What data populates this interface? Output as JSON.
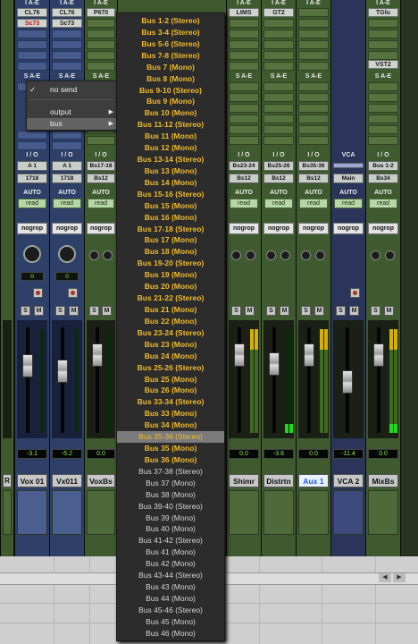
{
  "context_menu": {
    "check": "✓",
    "items": [
      "no send",
      "output",
      "bus"
    ]
  },
  "bus_menu": {
    "items": [
      {
        "label": "Bus 1-2 (Stereo)",
        "state": "used"
      },
      {
        "label": "Bus 3-4 (Stereo)",
        "state": "used"
      },
      {
        "label": "Bus 5-6 (Stereo)",
        "state": "used"
      },
      {
        "label": "Bus 7-8 (Stereo)",
        "state": "used"
      },
      {
        "label": "Bus 7 (Mono)",
        "state": "used"
      },
      {
        "label": "Bus 8 (Mono)",
        "state": "used"
      },
      {
        "label": "Bus 9-10 (Stereo)",
        "state": "used"
      },
      {
        "label": "Bus 9 (Mono)",
        "state": "used"
      },
      {
        "label": "Bus 10 (Mono)",
        "state": "used"
      },
      {
        "label": "Bus 11-12 (Stereo)",
        "state": "used"
      },
      {
        "label": "Bus 11 (Mono)",
        "state": "used"
      },
      {
        "label": "Bus 12 (Mono)",
        "state": "used"
      },
      {
        "label": "Bus 13-14 (Stereo)",
        "state": "used"
      },
      {
        "label": "Bus 13 (Mono)",
        "state": "used"
      },
      {
        "label": "Bus 14 (Mono)",
        "state": "used"
      },
      {
        "label": "Bus 15-16 (Stereo)",
        "state": "used"
      },
      {
        "label": "Bus 15 (Mono)",
        "state": "used"
      },
      {
        "label": "Bus 16 (Mono)",
        "state": "used"
      },
      {
        "label": "Bus 17-18 (Stereo)",
        "state": "used"
      },
      {
        "label": "Bus 17 (Mono)",
        "state": "used"
      },
      {
        "label": "Bus 18 (Mono)",
        "state": "used"
      },
      {
        "label": "Bus 19-20 (Stereo)",
        "state": "used"
      },
      {
        "label": "Bus 19 (Mono)",
        "state": "used"
      },
      {
        "label": "Bus 20 (Mono)",
        "state": "used"
      },
      {
        "label": "Bus 21-22 (Stereo)",
        "state": "used"
      },
      {
        "label": "Bus 21 (Mono)",
        "state": "used"
      },
      {
        "label": "Bus 22 (Mono)",
        "state": "used"
      },
      {
        "label": "Bus 23-24 (Stereo)",
        "state": "used"
      },
      {
        "label": "Bus 23 (Mono)",
        "state": "used"
      },
      {
        "label": "Bus 24 (Mono)",
        "state": "used"
      },
      {
        "label": "Bus 25-26 (Stereo)",
        "state": "used"
      },
      {
        "label": "Bus 25 (Mono)",
        "state": "used"
      },
      {
        "label": "Bus 26 (Mono)",
        "state": "used"
      },
      {
        "label": "Bus 33-34 (Stereo)",
        "state": "used"
      },
      {
        "label": "Bus 33 (Mono)",
        "state": "used"
      },
      {
        "label": "Bus 34 (Mono)",
        "state": "used"
      },
      {
        "label": "Bus 35-36 (Stereo)",
        "state": "highlighted"
      },
      {
        "label": "Bus 35 (Mono)",
        "state": "used"
      },
      {
        "label": "Bus 36 (Mono)",
        "state": "used"
      },
      {
        "label": "Bus 37-38 (Stereo)",
        "state": "free"
      },
      {
        "label": "Bus 37 (Mono)",
        "state": "free"
      },
      {
        "label": "Bus 38 (Mono)",
        "state": "free"
      },
      {
        "label": "Bus 39-40 (Stereo)",
        "state": "free"
      },
      {
        "label": "Bus 39 (Mono)",
        "state": "free"
      },
      {
        "label": "Bus 40 (Mono)",
        "state": "free"
      },
      {
        "label": "Bus 41-42 (Stereo)",
        "state": "free"
      },
      {
        "label": "Bus 41 (Mono)",
        "state": "free"
      },
      {
        "label": "Bus 42 (Mono)",
        "state": "free"
      },
      {
        "label": "Bus 43-44 (Stereo)",
        "state": "free"
      },
      {
        "label": "Bus 43 (Mono)",
        "state": "free"
      },
      {
        "label": "Bus 44 (Mono)",
        "state": "free"
      },
      {
        "label": "Bus 45-46 (Stereo)",
        "state": "free"
      },
      {
        "label": "Bus 45 (Mono)",
        "state": "free"
      },
      {
        "label": "Bus 46 (Mono)",
        "state": "free"
      }
    ]
  },
  "colors": {
    "used_bus": "#f0bb2d",
    "free_bus": "#d4d4d4",
    "volume_text": "#93e35b",
    "track_green": "#3f5a2f",
    "track_blue": "#2f4068"
  },
  "labels": {
    "sends_header": "S A-E",
    "io_header": "I / O",
    "auto_header": "AUTO",
    "read": "read",
    "nogroup": "nogrop",
    "solo": "S",
    "mute": "M",
    "vca_header": "VCA",
    "inserts_header": "I A-E"
  },
  "strips": [
    {
      "id": "s0",
      "name": "R",
      "color": "green",
      "insert1": "",
      "insert2": "",
      "input": "",
      "output": "",
      "volume": ""
    },
    {
      "id": "s1",
      "name": "Vox 01",
      "color": "blue",
      "insert1": "CL76",
      "insert2": "Sc73",
      "input": "A 1",
      "output": "1718",
      "volume": "-3.1",
      "pan": "0"
    },
    {
      "id": "s2",
      "name": "Vx011",
      "color": "blue",
      "insert1": "CL76",
      "insert2": "Sc73",
      "input": "A 1",
      "output": "1718",
      "volume": "-5.2",
      "pan": "0"
    },
    {
      "id": "s3",
      "name": "VoxBs",
      "color": "green",
      "insert1": "P670",
      "insert2": "",
      "input": "Bs17-18",
      "output": "Bs12",
      "volume": "0.0"
    },
    {
      "id": "s4",
      "name": "Shimr",
      "color": "green",
      "insert1": "LtMS",
      "insert2": "",
      "input": "Bs23-24",
      "output": "Bs12",
      "volume": "0.0"
    },
    {
      "id": "s5",
      "name": "Distrtn",
      "color": "green",
      "insert1": "GT2",
      "insert2": "",
      "input": "Bs25-26",
      "output": "Bs12",
      "volume": "-3.6"
    },
    {
      "id": "s6",
      "name": "Aux 1",
      "color": "green",
      "insert1": "",
      "insert2": "",
      "input": "Bs35-36",
      "output": "Bs12",
      "volume": "0.0"
    },
    {
      "id": "s7",
      "name": "VCA 2",
      "color": "vca",
      "insert1": "",
      "insert2": "",
      "input": "",
      "output": "Main",
      "volume": "-11.4"
    },
    {
      "id": "s8",
      "name": "MixBs",
      "color": "green",
      "insert1": "TGlu",
      "insert2": "VST2",
      "input": "Bus 1-2",
      "output": "Bs34",
      "volume": "0.0"
    }
  ]
}
